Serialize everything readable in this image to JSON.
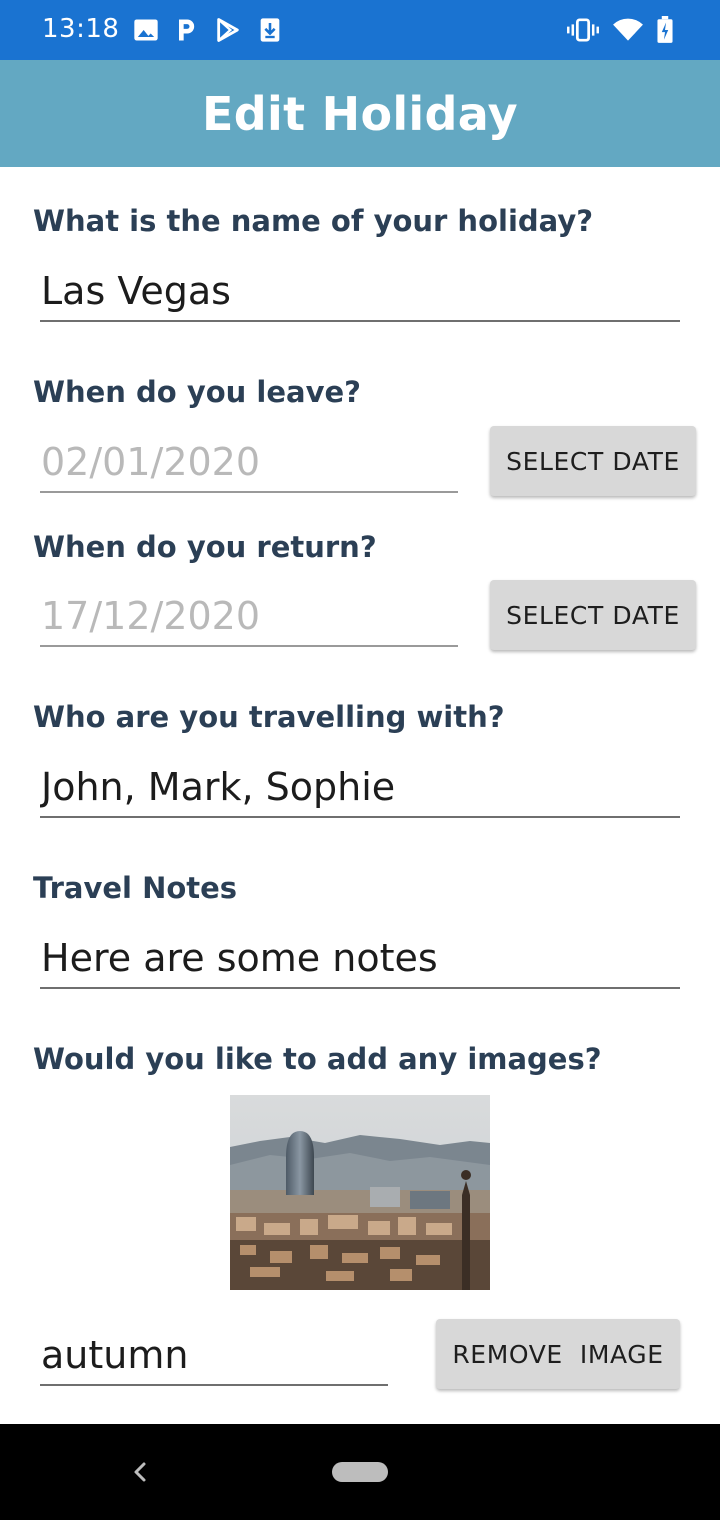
{
  "status_bar": {
    "time": "13:18",
    "left_icons": [
      "image-icon",
      "p-icon",
      "play-store-icon",
      "download-icon"
    ],
    "right_icons": [
      "vibrate-icon",
      "wifi-icon",
      "battery-icon"
    ]
  },
  "app_bar": {
    "title": "Edit Holiday",
    "color": "#63a8c2"
  },
  "form": {
    "name_label": "What is the name of your holiday?",
    "name_value": "Las Vegas",
    "leave_label": "When do you leave?",
    "leave_date": "02/01/2020",
    "leave_button": "SELECT DATE",
    "return_label": "When do you return?",
    "return_date": "17/12/2020",
    "return_button": "SELECT DATE",
    "companions_label": "Who are you travelling with?",
    "companions_value": "John, Mark, Sophie",
    "notes_label": "Travel Notes",
    "notes_value": "Here are some notes",
    "images_label": "Would you like to add any images?",
    "image_caption_value": "autumn",
    "remove_button": "REMOVE  IMAGE"
  },
  "colors": {
    "status_bar": "#1a73d1",
    "label_text": "#2b3f55",
    "button_bg": "#d8d8d8"
  }
}
